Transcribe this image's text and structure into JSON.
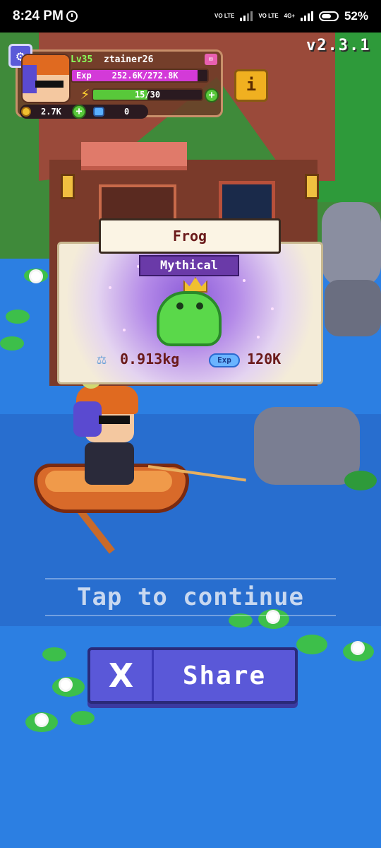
{
  "status_bar": {
    "time": "8:24 PM",
    "network_1": "VO LTE",
    "network_2": "VO LTE",
    "network_3": "4G+",
    "battery_percent": "52%"
  },
  "player": {
    "level": "Lv35",
    "username": "ztainer26",
    "exp_label": "Exp",
    "exp_value": "252.6K/272.8K",
    "exp_fraction": 0.926,
    "energy_value": "15/30",
    "energy_fraction": 0.5,
    "coins": "2.7K",
    "gems": "0"
  },
  "version": "v2.3.1",
  "info_button_label": "i",
  "catch": {
    "fish_name": "Frog",
    "rarity": "Mythical",
    "weight": "0.913kg",
    "exp_badge": "Exp",
    "exp_reward": "120K"
  },
  "tap_to_continue": "Tap to continue",
  "share": {
    "icon_label": "X",
    "label": "Share"
  },
  "colors": {
    "water": "#2c7fe2",
    "share_button": "#5a58d8",
    "rarity_badge": "#6a3aa8",
    "exp_bar": "#d33ad8",
    "energy_bar": "#58c83a"
  }
}
